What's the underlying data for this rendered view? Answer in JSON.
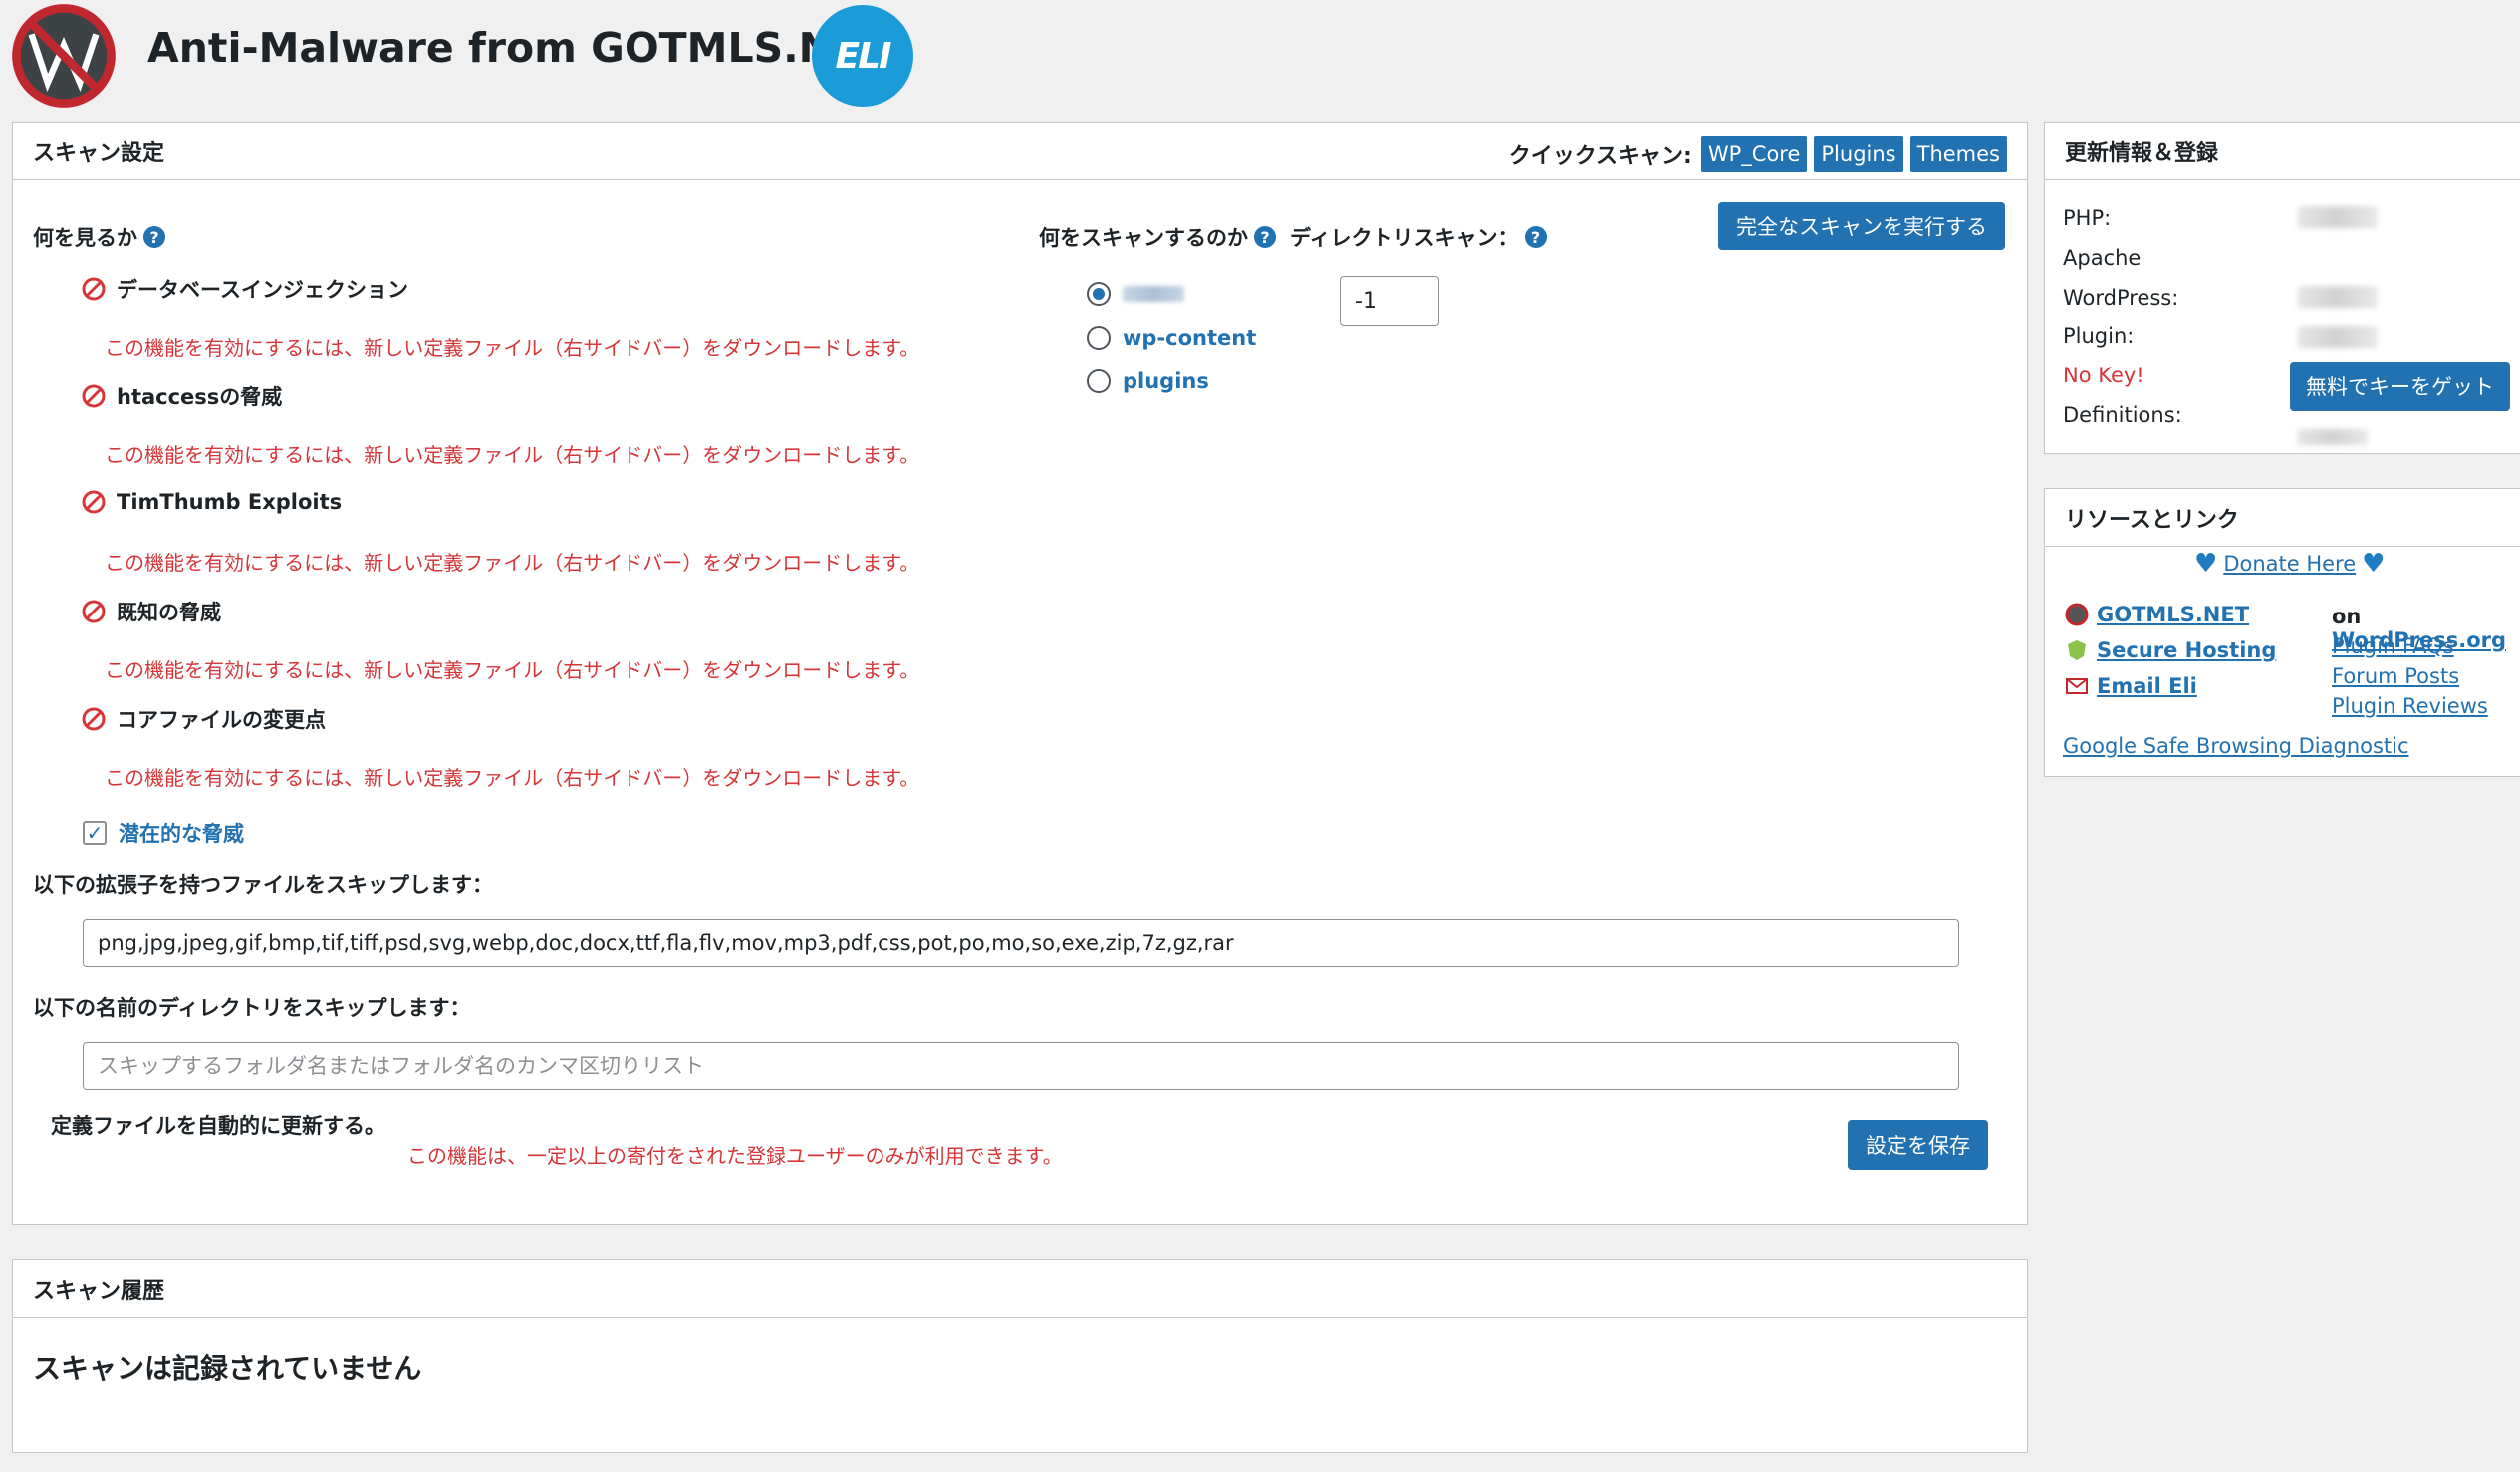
{
  "header": {
    "title": "Anti-Malware from GOTMLS.NET",
    "logo_icon": "gotmls-logo-icon",
    "badge_text": "ELI"
  },
  "scan_settings": {
    "title": "スキャン設定",
    "quick_scan_label": "クイックスキャン:",
    "quick_buttons": [
      "WP_Core",
      "Plugins",
      "Themes"
    ],
    "full_scan_button": "完全なスキャンを実行する",
    "what_to_look_for": "何を見るか",
    "options": [
      {
        "label": "データベースインジェクション"
      },
      {
        "label": "htaccessの脅威"
      },
      {
        "label": "TimThumb Exploits"
      },
      {
        "label": "既知の脅威"
      },
      {
        "label": "コアファイルの変更点"
      }
    ],
    "warning": "この機能を有効にするには、新しい定義ファイル（右サイドバー）をダウンロードします。",
    "potential_threats": "潜在的な脅威",
    "what_to_scan": "何をスキャンするのか",
    "dir_scan": "ディレクトリスキャン：",
    "scan_targets": [
      "wp-content",
      "plugins"
    ],
    "dir_depth": "-1",
    "skip_ext_label": "以下の拡張子を持つファイルをスキップします：",
    "skip_ext_value": "png,jpg,jpeg,gif,bmp,tif,tiff,psd,svg,webp,doc,docx,ttf,fla,flv,mov,mp3,pdf,css,pot,po,mo,so,exe,zip,7z,gz,rar",
    "skip_dir_label": "以下の名前のディレクトリをスキップします：",
    "skip_dir_placeholder": "スキップするフォルダ名またはフォルダ名のカンマ区切りリスト",
    "auto_update_label": "定義ファイルを自動的に更新する。",
    "auto_update_note": "この機能は、一定以上の寄付をされた登録ユーザーのみが利用できます。",
    "save_button": "設定を保存"
  },
  "history": {
    "title": "スキャン履歴",
    "empty": "スキャンは記録されていません"
  },
  "update_info": {
    "title": "更新情報＆登録",
    "php": "PHP:",
    "apache": "Apache",
    "wordpress": "WordPress:",
    "plugin": "Plugin:",
    "no_key": "No Key!",
    "get_key_button": "無料でキーをゲット",
    "definitions": "Definitions:"
  },
  "resources": {
    "title": "リソースとリンク",
    "donate": "Donate Here",
    "gotmls": "GOTMLS.NET",
    "hosting": "Secure Hosting",
    "email": "Email Eli",
    "on_label": "on",
    "wp_org": "WordPress.org",
    "faqs": "Plugin FAQs",
    "forum": "Forum Posts",
    "reviews": "Plugin Reviews",
    "safe_browsing": "Google Safe Browsing Diagnostic"
  },
  "colors": {
    "primary": "#2271b1",
    "error": "#d63638",
    "background": "#f0f0f1"
  }
}
